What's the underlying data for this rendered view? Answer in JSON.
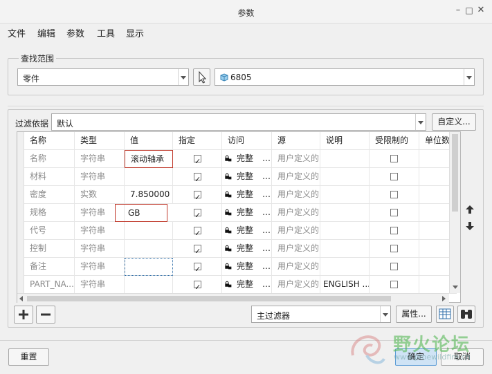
{
  "window": {
    "title": "参数",
    "minimize": "–",
    "maximize": "□",
    "close": "✕"
  },
  "menu": [
    "文件",
    "编辑",
    "参数",
    "工具",
    "显示"
  ],
  "search_scope": {
    "label": "查找范围",
    "type_value": "零件",
    "part_value": "6805"
  },
  "filter": {
    "label": "过滤依据",
    "value": "默认",
    "custom_button": "自定义..."
  },
  "table": {
    "columns": [
      "名称",
      "类型",
      "值",
      "指定",
      "访问",
      "源",
      "说明",
      "受限制的",
      "单位数量"
    ],
    "rows": [
      {
        "name": "名称",
        "type": "字符串",
        "value": "滚动轴承",
        "designate": true,
        "access": "完整",
        "source": "用户定义的",
        "desc": "",
        "restricted": false,
        "highlight": true
      },
      {
        "name": "材料",
        "type": "字符串",
        "value": "",
        "designate": true,
        "access": "完整",
        "source": "用户定义的",
        "desc": "",
        "restricted": false,
        "highlight": false
      },
      {
        "name": "密度",
        "type": "实数",
        "value": "7.850000",
        "designate": true,
        "access": "完整",
        "source": "用户定义的",
        "desc": "",
        "restricted": false,
        "highlight": false
      },
      {
        "name": "规格",
        "type": "字符串",
        "value": "GB",
        "designate": true,
        "access": "完整",
        "source": "用户定义的",
        "desc": "",
        "restricted": false,
        "highlight": true
      },
      {
        "name": "代号",
        "type": "字符串",
        "value": "",
        "designate": true,
        "access": "完整",
        "source": "用户定义的",
        "desc": "",
        "restricted": false,
        "highlight": false
      },
      {
        "name": "控制",
        "type": "字符串",
        "value": "",
        "designate": true,
        "access": "完整",
        "source": "用户定义的",
        "desc": "",
        "restricted": false,
        "highlight": false
      },
      {
        "name": "备注",
        "type": "字符串",
        "value": "",
        "designate": true,
        "access": "完整",
        "source": "用户定义的",
        "desc": "",
        "restricted": false,
        "highlight": false
      },
      {
        "name": "PART_NA...",
        "type": "字符串",
        "value": "",
        "designate": true,
        "access": "完整",
        "source": "用户定义的",
        "desc": "ENGLISH ...",
        "restricted": false,
        "highlight": false
      }
    ]
  },
  "bottom": {
    "main_filter": "主过滤器",
    "properties_button": "属性...",
    "reset_button": "重置",
    "ok_button": "确定",
    "cancel_button": "取消"
  },
  "watermark": {
    "text": "野火论坛",
    "url": "www.proewildfire.cn"
  },
  "colors": {
    "highlight_border": "#c0392b",
    "primary_button": "#cfe3f5"
  }
}
